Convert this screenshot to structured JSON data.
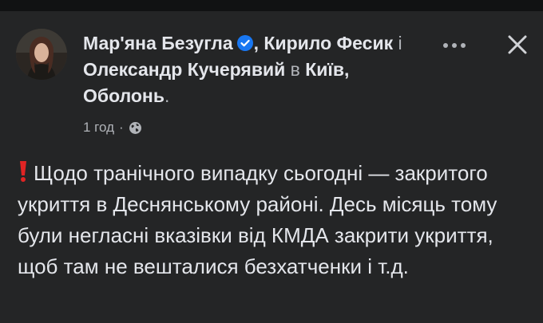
{
  "post": {
    "author_1": "Мар'яна Безугла",
    "author_1_sep": ",",
    "author_2": "Кирило Фесик",
    "conj": "і",
    "author_3": "Олександр Кучерявий",
    "location_prefix": "в",
    "location": "Київ, Оболонь",
    "location_suffix": ".",
    "time": "1 год",
    "time_sep": "·",
    "privacy_icon": "globe-icon",
    "more_icon": "ellipsis-icon",
    "close_icon": "close-icon",
    "emoji": "red-exclamation-icon",
    "text": "Щодо транічного випадку сьогодні — закритого укриття в Деснянському районі. Десь місяць тому були негласні вказівки від КМДА закрити укриття, щоб там не вешталися безхатченки і т.д."
  },
  "colors": {
    "background": "#242526",
    "text_primary": "#e4e6eb",
    "text_secondary": "#b0b3b8",
    "verified_badge": "#1877f2",
    "exclamation": "#e02424"
  }
}
